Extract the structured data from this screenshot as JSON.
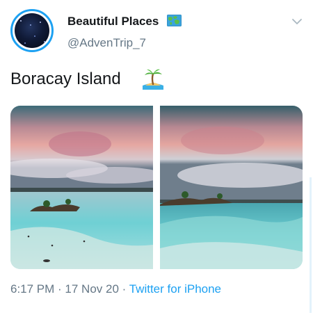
{
  "user": {
    "display_name": "Beautiful Places",
    "handle": "@AdvenTrip_7",
    "name_emoji": "world-map-icon",
    "avatar": "starry-night-avatar"
  },
  "tweet": {
    "text": "Boracay Island",
    "text_emoji": "desert-island-icon",
    "photos": [
      "boracay-aerial-photo",
      "boracay-shoreline-photo"
    ]
  },
  "meta": {
    "time": "6:17 PM",
    "separator": " · ",
    "date": "17 Nov 20",
    "source": "Twitter for iPhone"
  },
  "colors": {
    "accent": "#1da1f2",
    "text": "#14171a",
    "muted": "#657786"
  }
}
